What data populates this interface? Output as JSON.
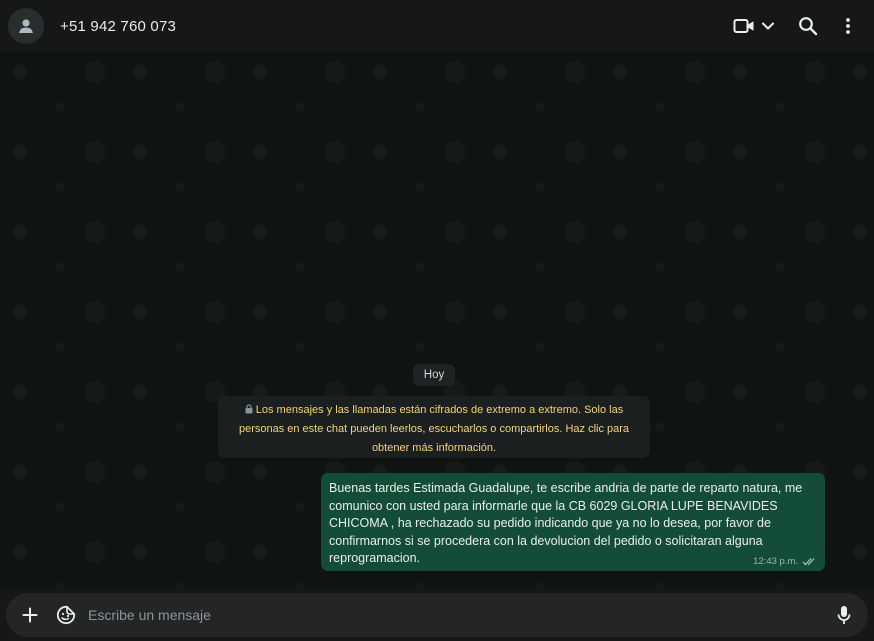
{
  "header": {
    "contact_name": "+51 942 760 073",
    "icons": [
      "avatar-default-icon",
      "video-icon",
      "chevron-down-icon",
      "search-icon",
      "more-vertical-icon"
    ]
  },
  "chat": {
    "date_chip": "Hoy",
    "encryption_notice": "Los mensajes y las llamadas están cifrados de extremo a extremo. Solo las personas en este chat pueden leerlos, escucharlos o compartirlos. Haz clic para obtener más información.",
    "messages": [
      {
        "text": "Buenas tardes Estimada Guadalupe, te escribe andria de parte de reparto natura, me comunico con usted para informarle que la CB 6029 GLORIA LUPE BENAVIDES CHICOMA , ha rechazado su pedido indicando que ya no lo desea, por favor de confirmarnos si se procedera con la devolucion del pedido o solicitaran alguna reprogramacion.",
        "time": "12:43 p.m.",
        "status": "read"
      }
    ]
  },
  "composer": {
    "placeholder": "Escribe un mensaje",
    "icons": [
      "plus-icon",
      "sticker-icon",
      "microphone-icon"
    ]
  },
  "colors": {
    "outgoing_bubble": "#144d37",
    "notice_text": "#f5d27a",
    "accent": "#21c063"
  }
}
